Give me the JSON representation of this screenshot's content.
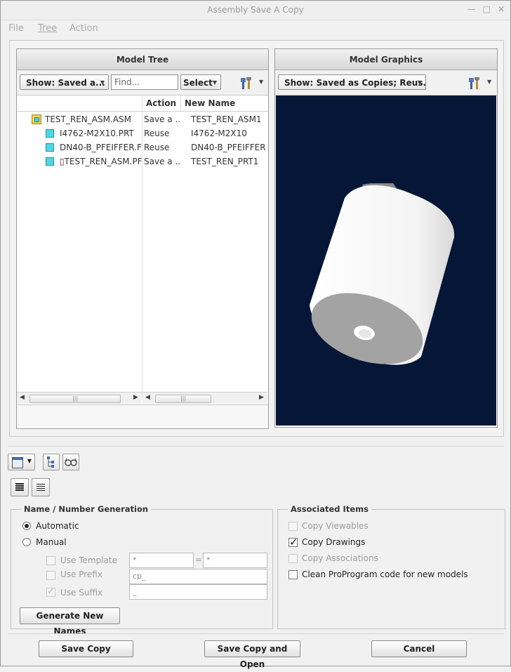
{
  "window": {
    "title": "Assembly Save A Copy"
  },
  "menu": [
    "File",
    "Tree",
    "Action"
  ],
  "model_tree": {
    "title": "Model Tree",
    "show_combo": "Show: Saved a...",
    "find_placeholder": "Find...",
    "select_label": "Select",
    "columns": [
      "Action",
      "New Name"
    ],
    "rows": [
      {
        "name": "TEST_REN_ASM.ASM",
        "action": "Save a ...",
        "new_name": "TEST_REN_ASM1",
        "kind": "assembly"
      },
      {
        "name": "I4762-M2X10.PRT",
        "action": "Reuse",
        "new_name": "I4762-M2X10",
        "kind": "part"
      },
      {
        "name": "DN40-B_PFEIFFER.F",
        "action": "Reuse",
        "new_name": "DN40-B_PFEIFFER",
        "kind": "part"
      },
      {
        "name": "▯TEST_REN_ASM.PF",
        "action": "Save a ...",
        "new_name": "TEST_REN_PRT1",
        "kind": "part"
      }
    ]
  },
  "model_graphics": {
    "title": "Model Graphics",
    "show_combo": "Show: Saved as Copies; Reus...",
    "background": "#051637"
  },
  "name_generation": {
    "title": "Name / Number Generation",
    "automatic": "Automatic",
    "manual": "Manual",
    "use_template": "Use Template",
    "template_value_1": "*",
    "equals": "=",
    "template_value_2": "*",
    "use_prefix": "Use Prefix",
    "prefix_value": "cp_",
    "use_suffix": "Use Suffix",
    "suffix_value": "_",
    "generate_button": "Generate New Names"
  },
  "associated_items": {
    "title": "Associated Items",
    "copy_viewables": "Copy Viewables",
    "copy_drawings": "Copy Drawings",
    "copy_associations": "Copy Associations",
    "clean_proprogram": "Clean ProProgram code for new models"
  },
  "footer": {
    "save_copy": "Save Copy",
    "save_copy_open": "Save Copy and Open",
    "cancel": "Cancel"
  },
  "icons": {
    "minimize": "minimize-icon",
    "maximize": "maximize-icon",
    "close": "close-icon",
    "tools": "tools-icon",
    "layout": "layout-icon",
    "tree_view": "tree-view-icon",
    "glasses": "glasses-icon",
    "details_view": "details-view-icon",
    "list_view": "list-view-icon"
  }
}
